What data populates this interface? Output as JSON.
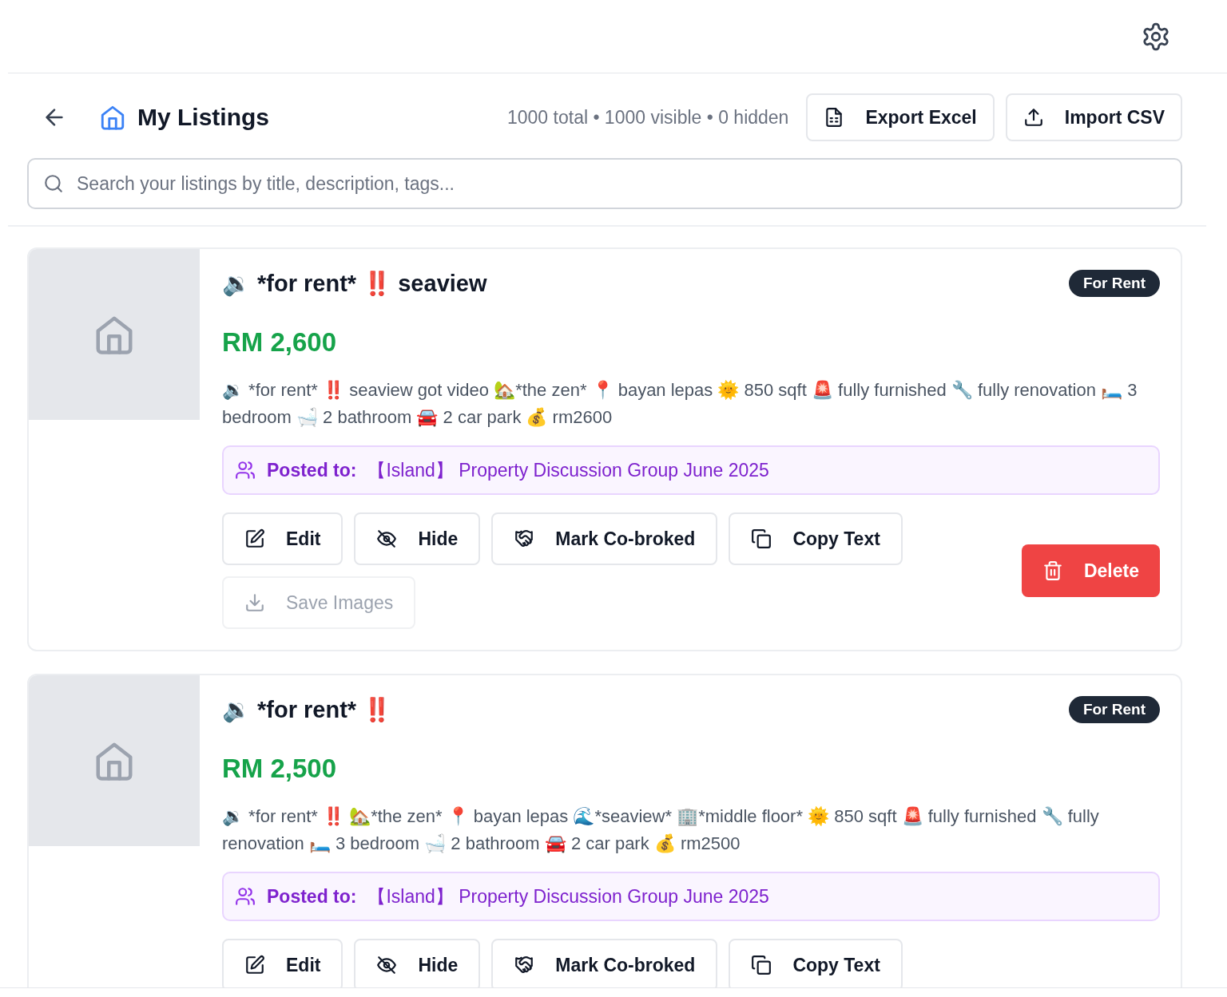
{
  "header": {
    "title": "My Listings",
    "stats": "1000 total • 1000 visible • 0 hidden",
    "actions": [
      {
        "label": "Export Excel",
        "kind": "export"
      },
      {
        "label": "Import CSV",
        "kind": "import"
      }
    ]
  },
  "search": {
    "placeholder": "Search your listings by title, description, tags..."
  },
  "listings": [
    {
      "title": "🔉 *for rent* ‼️ seaview",
      "badge": "For Rent",
      "price": "RM 2,600",
      "description": "🔉 *for rent* ‼️ seaview got video 🏡*the zen* 📍 bayan lepas 🌞 850 sqft 🚨 fully furnished 🔧 fully renovation 🛏️ 3 bedroom 🛁 2 bathroom 🚘 2 car park 💰 rm2600",
      "posted_label": "Posted to:",
      "posted_group": "【Island】 Property Discussion Group June 2025",
      "actions": [
        {
          "label": "Edit",
          "kind": "edit",
          "disabled": false
        },
        {
          "label": "Hide",
          "kind": "hide",
          "disabled": false
        },
        {
          "label": "Mark Co-broked",
          "kind": "cobroke",
          "disabled": false
        },
        {
          "label": "Copy Text",
          "kind": "copy",
          "disabled": false
        },
        {
          "label": "Save Images",
          "kind": "save",
          "disabled": true
        }
      ],
      "delete": "Delete"
    },
    {
      "title": "🔉 *for rent* ‼️",
      "badge": "For Rent",
      "price": "RM 2,500",
      "description": "🔉 *for rent* ‼️ 🏡*the zen* 📍 bayan lepas 🌊*seaview* 🏢*middle floor* 🌞 850 sqft 🚨 fully furnished 🔧 fully renovation 🛏️ 3 bedroom 🛁 2 bathroom 🚘 2 car park 💰 rm2500",
      "posted_label": "Posted to:",
      "posted_group": "【Island】 Property Discussion Group June 2025",
      "actions": [
        {
          "label": "Edit",
          "kind": "edit",
          "disabled": false
        },
        {
          "label": "Hide",
          "kind": "hide",
          "disabled": false
        },
        {
          "label": "Mark Co-broked",
          "kind": "cobroke",
          "disabled": false
        },
        {
          "label": "Copy Text",
          "kind": "copy",
          "disabled": false
        }
      ]
    }
  ]
}
